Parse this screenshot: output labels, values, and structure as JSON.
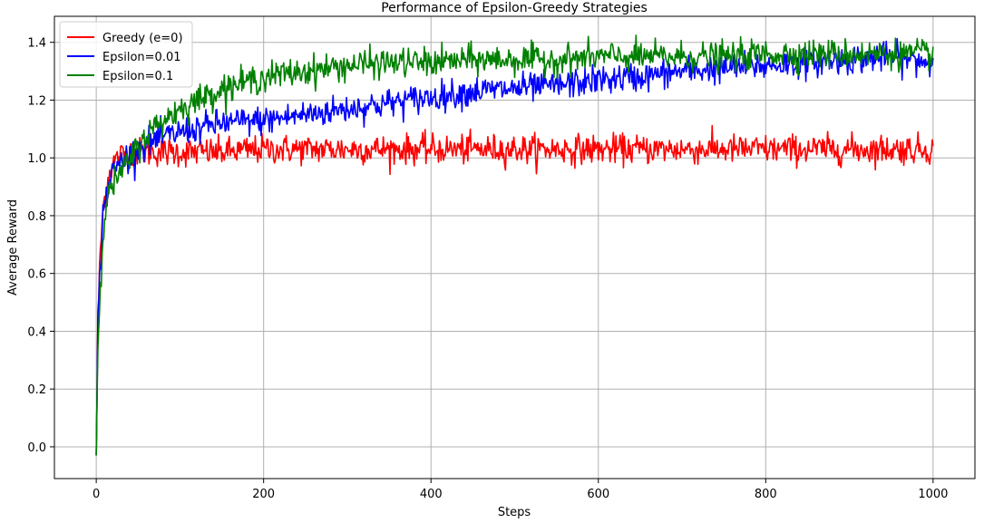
{
  "chart_data": {
    "type": "line",
    "title": "Performance of Epsilon-Greedy Strategies",
    "xlabel": "Steps",
    "ylabel": "Average Reward",
    "xlim": [
      -50,
      1050
    ],
    "ylim": [
      -0.11,
      1.49
    ],
    "xticks": [
      0,
      200,
      400,
      600,
      800,
      1000
    ],
    "yticks": [
      0.0,
      0.2,
      0.4,
      0.6,
      0.8,
      1.0,
      1.2,
      1.4
    ],
    "xtick_labels": [
      "0",
      "200",
      "400",
      "600",
      "800",
      "1000"
    ],
    "ytick_labels": [
      "0.0",
      "0.2",
      "0.4",
      "0.6",
      "0.8",
      "1.0",
      "1.2",
      "1.4"
    ],
    "grid": true,
    "legend_position": "top-left",
    "series": [
      {
        "name": "Greedy (e=0)",
        "color": "#ff0000",
        "x": [
          0,
          2,
          5,
          8,
          12,
          16,
          20,
          25,
          30,
          40,
          50,
          60,
          80,
          100,
          150,
          200,
          250,
          300,
          350,
          400,
          450,
          500,
          550,
          600,
          650,
          700,
          750,
          800,
          850,
          900,
          950,
          1000
        ],
        "values": [
          -0.03,
          0.45,
          0.68,
          0.82,
          0.9,
          0.95,
          0.98,
          1.0,
          1.01,
          1.02,
          1.02,
          1.02,
          1.02,
          1.02,
          1.02,
          1.03,
          1.03,
          1.03,
          1.03,
          1.03,
          1.03,
          1.03,
          1.03,
          1.03,
          1.03,
          1.03,
          1.03,
          1.03,
          1.03,
          1.03,
          1.03,
          1.03
        ],
        "noise": 0.025
      },
      {
        "name": "Epsilon=0.01",
        "color": "#0000ff",
        "x": [
          0,
          2,
          5,
          8,
          12,
          16,
          20,
          25,
          30,
          40,
          50,
          60,
          80,
          100,
          150,
          200,
          250,
          300,
          350,
          400,
          450,
          500,
          550,
          600,
          650,
          700,
          750,
          800,
          850,
          900,
          950,
          1000
        ],
        "values": [
          -0.03,
          0.42,
          0.65,
          0.8,
          0.88,
          0.92,
          0.95,
          0.97,
          0.99,
          1.01,
          1.03,
          1.05,
          1.07,
          1.09,
          1.12,
          1.13,
          1.15,
          1.17,
          1.19,
          1.21,
          1.23,
          1.24,
          1.25,
          1.27,
          1.28,
          1.3,
          1.31,
          1.32,
          1.33,
          1.34,
          1.35,
          1.33
        ],
        "noise": 0.025
      },
      {
        "name": "Epsilon=0.1",
        "color": "#008000",
        "x": [
          0,
          2,
          5,
          8,
          12,
          16,
          20,
          25,
          30,
          40,
          50,
          60,
          80,
          100,
          150,
          200,
          250,
          300,
          350,
          400,
          450,
          500,
          550,
          600,
          650,
          700,
          750,
          800,
          850,
          900,
          950,
          1000
        ],
        "values": [
          -0.03,
          0.35,
          0.58,
          0.74,
          0.84,
          0.88,
          0.91,
          0.93,
          0.95,
          0.99,
          1.04,
          1.08,
          1.13,
          1.17,
          1.24,
          1.28,
          1.3,
          1.32,
          1.33,
          1.33,
          1.34,
          1.34,
          1.34,
          1.35,
          1.35,
          1.35,
          1.35,
          1.36,
          1.36,
          1.36,
          1.36,
          1.36
        ],
        "noise": 0.025
      }
    ]
  }
}
